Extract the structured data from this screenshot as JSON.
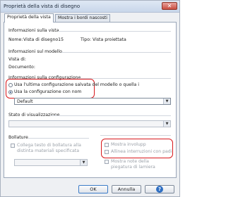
{
  "window": {
    "title": "Proprietà della vista di disegno",
    "close_glyph": "✕"
  },
  "tabs": [
    {
      "label": "Proprietà della vista"
    },
    {
      "label": "Mostra i bordi nascosti"
    }
  ],
  "view_info": {
    "heading": "Informazioni sulla vista",
    "name_label": "Nome:",
    "name_value": "Vista di disegno15",
    "type_label": "Tipo:",
    "type_value": "Vista proiettata"
  },
  "model_info": {
    "heading": "Informazioni sul modello",
    "view_of_label": "Vista di:",
    "document_label": "Documento:"
  },
  "config_info": {
    "heading": "Informazioni sulla configurazione",
    "option_saved": "Usa l'ultima configurazione salvata del modello o quella i",
    "option_named": "Usa la configurazione con nom",
    "selected_option": "named",
    "config_value": "Default"
  },
  "display_state": {
    "heading": "Stato di visualizzazione"
  },
  "bom": {
    "heading": "Bollature",
    "link_checkbox_label_1": "Collega testo di bollatura alla",
    "link_checkbox_label_2": "distinta materiali specificata"
  },
  "options": {
    "show_envelope": "Mostra involupp",
    "align_breaks_1": "Allinea interruzioni con padi",
    "sheet_metal_1": "Mostra note della",
    "sheet_metal_2": "piegatura di lamiera"
  },
  "buttons": {
    "ok": "OK",
    "cancel": "Annulla",
    "help": "?"
  },
  "colors": {
    "highlight": "#d8171b",
    "default_button_border": "#3b7bc7"
  }
}
